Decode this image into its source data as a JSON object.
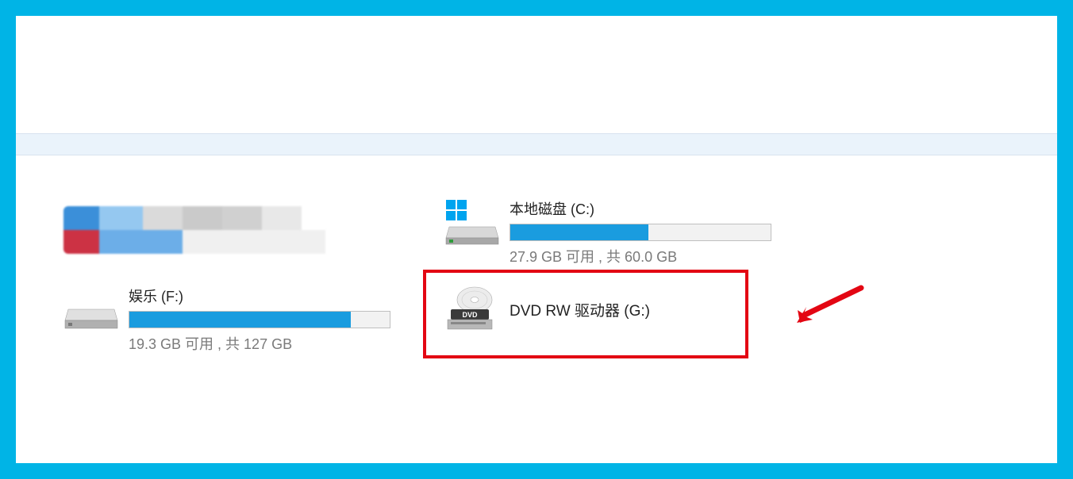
{
  "drives": {
    "c": {
      "title": "本地磁盘 (C:)",
      "status": "27.9 GB 可用 , 共 60.0 GB",
      "fill_percent": 53
    },
    "f": {
      "title": "娱乐 (F:)",
      "status": "19.3 GB 可用 , 共 127 GB",
      "fill_percent": 85
    },
    "dvd": {
      "title": "DVD RW 驱动器 (G:)"
    }
  },
  "icons": {
    "hdd": "hdd-icon",
    "hdd_win": "hdd-windows-icon",
    "dvd": "dvd-drive-icon"
  }
}
